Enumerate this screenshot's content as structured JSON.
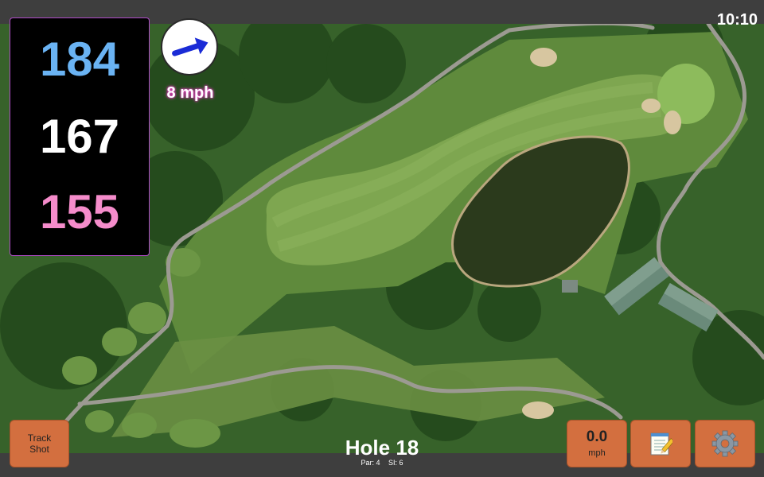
{
  "clock": "10:10",
  "distances": {
    "back": "184",
    "middle": "167",
    "front": "155",
    "colors": {
      "back": "#6ab3f3",
      "middle": "#ffffff",
      "front": "#f58ccb"
    }
  },
  "wind": {
    "speed_text": "8 mph",
    "direction_icon": "wind-arrow-icon"
  },
  "buttons": {
    "track_shot": "Track Shot",
    "speed_value": "0.0",
    "speed_unit": "mph",
    "notes_icon": "notepad-icon",
    "settings_icon": "gear-icon"
  },
  "hole": {
    "title": "Hole 18",
    "par": "Par: 4",
    "si": "SI: 6"
  },
  "colors": {
    "button": "#d36f3f",
    "panel": "#000000",
    "bar": "#3e3e3e"
  }
}
